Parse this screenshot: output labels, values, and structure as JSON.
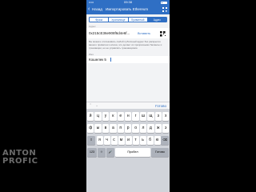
{
  "watermark": {
    "line1": "ANTON",
    "line2": "PROFIC"
  },
  "status_bar": {
    "carrier": "••••• ",
    "time": "09:38"
  },
  "nav": {
    "back_label": "Назад",
    "title": "Импортировать Ethereum"
  },
  "tabs": {
    "items": [
      {
        "label": "Фраза"
      },
      {
        "label": "Хранилище"
      },
      {
        "label": "Приватный"
      },
      {
        "label": "Адрес"
      }
    ],
    "selected": "Адрес"
  },
  "address": {
    "label": "Адрес",
    "value": "0x215cE36e908f6d4e6f...",
    "paste_label": "Вставить"
  },
  "info_text": "Вы можете отслеживать любой публичный адрес без раскрытия вашего приватного ключа, это делает их прозрачными балансы и транзакции, но не управлять транзакциями.",
  "name": {
    "label": "Имя",
    "value": "Кошелек 5"
  },
  "accessory": {
    "done_label": "Готово"
  },
  "keyboard": {
    "row1": [
      "й",
      "ц",
      "у",
      "к",
      "е",
      "н",
      "г",
      "ш",
      "щ",
      "з",
      "х"
    ],
    "row2": [
      "ф",
      "ы",
      "в",
      "а",
      "п",
      "р",
      "о",
      "л",
      "д",
      "ж",
      "э"
    ],
    "row3": [
      "я",
      "ч",
      "с",
      "м",
      "и",
      "т",
      "ь",
      "б",
      "ю"
    ],
    "shift_label": "⇧",
    "delete_label": "⌫",
    "numbers_label": "123",
    "emoji_label": "☺",
    "mic_label": "🎤",
    "space_label": "Пробел",
    "done_label": "Готово"
  },
  "colors": {
    "accent": "#2f6fc4",
    "background": "#f2f3f5",
    "keyboard": "#d1d4da"
  }
}
